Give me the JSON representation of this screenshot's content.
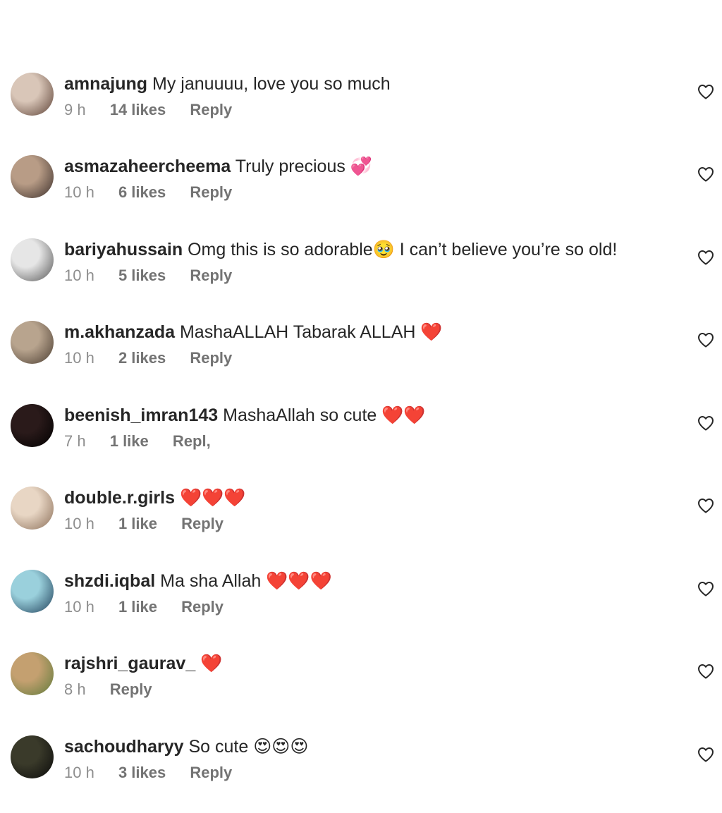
{
  "comments": [
    {
      "user": "amnajung",
      "text": "My januuuu, love you so much",
      "emoji": "",
      "time": "9 h",
      "likes": "14 likes",
      "reply": "Reply",
      "avatar": [
        "#d9c6b8",
        "#5b4034"
      ]
    },
    {
      "user": "asmazaheercheema",
      "text": "Truly precious",
      "emoji": "💞",
      "time": "10 h",
      "likes": "6 likes",
      "reply": "Reply",
      "avatar": [
        "#b89c86",
        "#3a2e2a"
      ]
    },
    {
      "user": "bariyahussain",
      "text": "Omg this is so adorable🥹 I can’t believe you’re so old!",
      "emoji": "",
      "time": "10 h",
      "likes": "5 likes",
      "reply": "Reply",
      "avatar": [
        "#e6e6e6",
        "#555555"
      ]
    },
    {
      "user": "m.akhanzada",
      "text": "MashaALLAH Tabarak ALLAH",
      "emoji": "❤️",
      "time": "10 h",
      "likes": "2 likes",
      "reply": "Reply",
      "avatar": [
        "#b8a48e",
        "#4a3c30"
      ]
    },
    {
      "user": "beenish_imran143",
      "text": "MashaAllah so cute",
      "emoji": "❤️❤️",
      "time": "7 h",
      "likes": "1 like",
      "reply": "Repl,",
      "avatar": [
        "#2a1a1a",
        "#000000"
      ]
    },
    {
      "user": "double.r.girls",
      "text": "",
      "emoji": "❤️❤️❤️",
      "time": "10 h",
      "likes": "1 like",
      "reply": "Reply",
      "avatar": [
        "#e8d6c4",
        "#8a6e58"
      ]
    },
    {
      "user": "shzdi.iqbal",
      "text": "Ma sha Allah",
      "emoji": "❤️❤️❤️",
      "time": "10 h",
      "likes": "1 like",
      "reply": "Reply",
      "avatar": [
        "#9ad0dc",
        "#1e3e58"
      ]
    },
    {
      "user": "rajshri_gaurav_",
      "text": "",
      "emoji": "❤️",
      "time": "8 h",
      "likes": "",
      "reply": "Reply",
      "avatar": [
        "#c4a070",
        "#5e7a3a"
      ]
    },
    {
      "user": "sachoudharyy",
      "text": "So cute",
      "emoji": "😍😍😍",
      "time": "10 h",
      "likes": "3 likes",
      "reply": "Reply",
      "avatar": [
        "#3a3a2a",
        "#0a0a0a"
      ]
    }
  ],
  "icons": {
    "like": "heart-outline-icon"
  },
  "colors": {
    "username": "#262626",
    "meta": "#8e8e8e",
    "heart_emoji": "#e0203a"
  }
}
